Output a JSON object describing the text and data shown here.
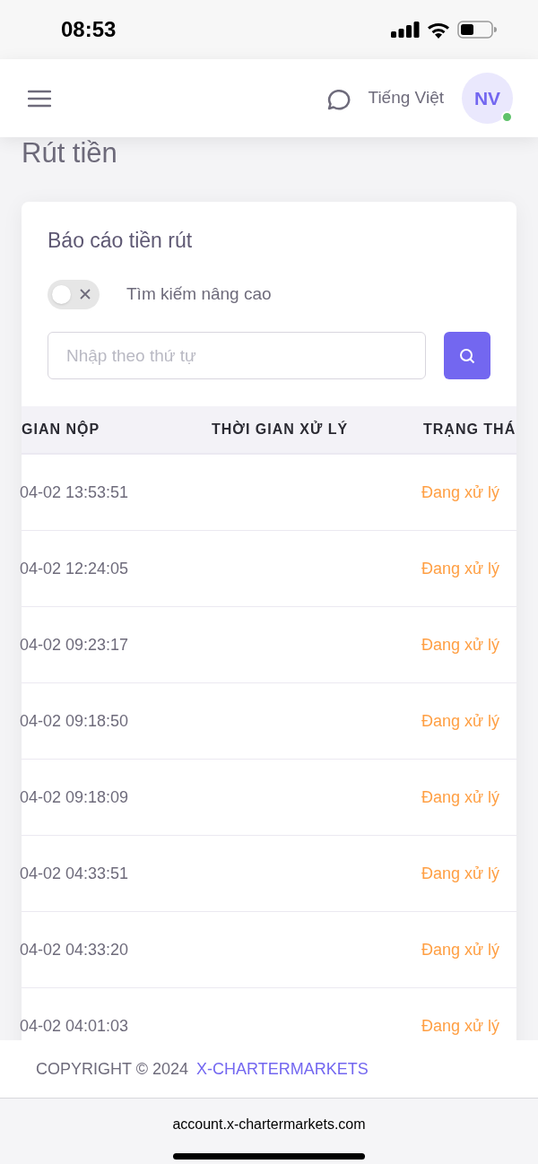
{
  "status_bar": {
    "time": "08:53"
  },
  "header": {
    "language": "Tiếng Việt",
    "avatar_initials": "NV",
    "online": true
  },
  "page_title": "Rút tiền",
  "card": {
    "title": "Báo cáo tiền rút",
    "advanced_search": {
      "label": "Tìm kiếm nâng cao",
      "on": false
    },
    "search": {
      "placeholder": "Nhập theo thứ tự"
    }
  },
  "table": {
    "columns": [
      "GIAN NỘP",
      "THỜI GIAN XỬ LÝ",
      "TRẠNG THÁ"
    ],
    "rows": [
      {
        "submitted": "04-02 13:53:51",
        "status": "Đang xử lý"
      },
      {
        "submitted": "04-02 12:24:05",
        "status": "Đang xử lý"
      },
      {
        "submitted": "04-02 09:23:17",
        "status": "Đang xử lý"
      },
      {
        "submitted": "04-02 09:18:50",
        "status": "Đang xử lý"
      },
      {
        "submitted": "04-02 09:18:09",
        "status": "Đang xử lý"
      },
      {
        "submitted": "04-02 04:33:51",
        "status": "Đang xử lý"
      },
      {
        "submitted": "04-02 04:33:20",
        "status": "Đang xử lý"
      },
      {
        "submitted": "04-02 04:01:03",
        "status": "Đang xử lý"
      }
    ]
  },
  "footer": {
    "copyright": "COPYRIGHT © 2024",
    "brand": "X-CHARTERMARKETS"
  },
  "browser": {
    "url": "account.x-chartermarkets.com"
  }
}
